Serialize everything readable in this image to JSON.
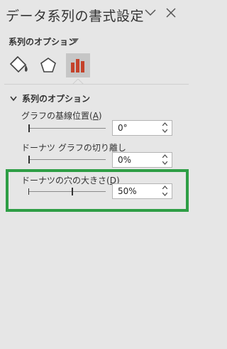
{
  "pane": {
    "title": "データ系列の書式設定",
    "options_menu_label": "系列のオプション"
  },
  "tabs": [
    {
      "name": "Fill & Line",
      "icon": "paint-bucket-icon",
      "selected": false
    },
    {
      "name": "Effects",
      "icon": "pentagon-icon",
      "selected": false
    },
    {
      "name": "Series Options",
      "icon": "bar-chart-icon",
      "selected": true
    }
  ],
  "section": {
    "title": "系列のオプション",
    "expanded": true
  },
  "fields": [
    {
      "label_pre": "グラフの基線位置(",
      "label_key": "A",
      "label_post": ")",
      "value": "0°",
      "slider_fraction": 0.0
    },
    {
      "label_pre": "ドーナツ グラフの切り離し",
      "label_key": "",
      "label_post": "",
      "value": "0%",
      "slider_fraction": 0.0
    },
    {
      "label_pre": "ドーナツの穴の大きさ(",
      "label_key": "D",
      "label_post": ")",
      "value": "50%",
      "slider_fraction": 0.5
    }
  ],
  "colors": {
    "highlight": "#2e9e45",
    "series_icon": "#c4422b",
    "selected_tab_bg": "#c6c6c6"
  }
}
